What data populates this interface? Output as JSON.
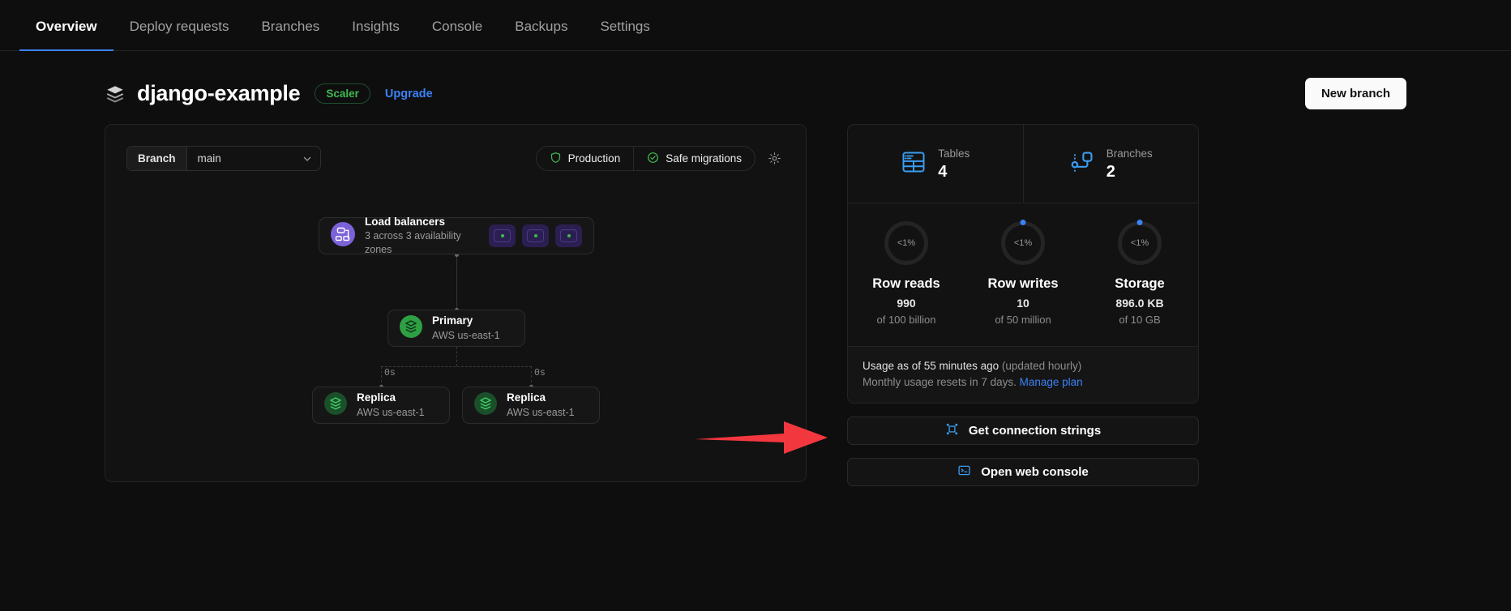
{
  "nav": {
    "tabs": [
      {
        "label": "Overview",
        "active": true
      },
      {
        "label": "Deploy requests",
        "active": false
      },
      {
        "label": "Branches",
        "active": false
      },
      {
        "label": "Insights",
        "active": false
      },
      {
        "label": "Console",
        "active": false
      },
      {
        "label": "Backups",
        "active": false
      },
      {
        "label": "Settings",
        "active": false
      }
    ]
  },
  "header": {
    "db_icon": "database-layers-icon",
    "title": "django-example",
    "plan_badge": "Scaler",
    "upgrade_label": "Upgrade",
    "new_branch_label": "New branch"
  },
  "topology": {
    "branch_selector": {
      "label": "Branch",
      "value": "main",
      "chevron": "chevron-down-icon"
    },
    "pills": [
      {
        "label": "Production",
        "icon": "shield-icon",
        "color": "#3fb950"
      },
      {
        "label": "Safe migrations",
        "icon": "check-circle-icon",
        "color": "#3fb950"
      }
    ],
    "settings_icon": "gear-icon",
    "load_balancer": {
      "title": "Load balancers",
      "subtitle": "3 across 3 availability zones",
      "icon": "load-balancer-icon",
      "zones": 3,
      "zone_status_color": "#3fb950"
    },
    "primary": {
      "title": "Primary",
      "subtitle": "AWS us-east-1",
      "icon": "database-node-icon"
    },
    "replicas": [
      {
        "title": "Replica",
        "subtitle": "AWS us-east-1",
        "lag": "0s",
        "icon": "database-node-icon"
      },
      {
        "title": "Replica",
        "subtitle": "AWS us-east-1",
        "lag": "0s",
        "icon": "database-node-icon"
      }
    ]
  },
  "stats": {
    "counts": [
      {
        "label": "Tables",
        "value": "4",
        "icon": "table-icon"
      },
      {
        "label": "Branches",
        "value": "2",
        "icon": "branch-icon"
      }
    ],
    "gauges": [
      {
        "name": "Row reads",
        "percent": "<1%",
        "value": "990",
        "limit": "of 100 billion",
        "tick": false
      },
      {
        "name": "Row writes",
        "percent": "<1%",
        "value": "10",
        "limit": "of 50 million",
        "tick": true
      },
      {
        "name": "Storage",
        "percent": "<1%",
        "value": "896.0 KB",
        "limit": "of 10 GB",
        "tick": true
      }
    ],
    "usage_note_main": "Usage as of 55 minutes ago",
    "usage_note_muted": "(updated hourly)",
    "usage_reset": "Monthly usage resets in 7 days.",
    "manage_plan_label": "Manage plan"
  },
  "actions": [
    {
      "label": "Get connection strings",
      "icon": "connection-icon"
    },
    {
      "label": "Open web console",
      "icon": "terminal-icon"
    }
  ],
  "annotation": {
    "arrow_color": "#f3373f",
    "points_to": "Get connection strings"
  }
}
